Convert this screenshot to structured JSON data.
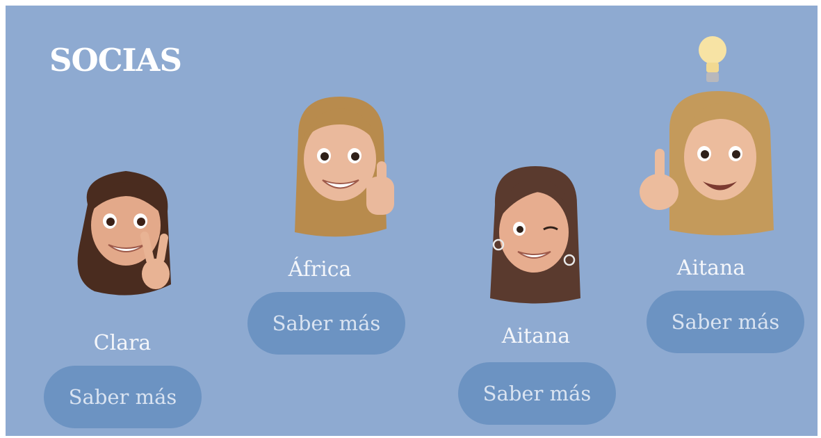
{
  "section": {
    "title": "SOCIAS"
  },
  "members": [
    {
      "name": "Clara",
      "button_label": "Saber más",
      "gesture": "peace-sign",
      "hair_color": "#4a2c1f"
    },
    {
      "name": "África",
      "button_label": "Saber más",
      "gesture": "thumbs-up",
      "hair_color": "#b88b4d"
    },
    {
      "name": "Aitana",
      "button_label": "Saber más",
      "gesture": "wink",
      "hair_color": "#5a3a2e"
    },
    {
      "name": "Aitana",
      "button_label": "Saber más",
      "gesture": "index-finger-idea",
      "hair_color": "#c49a5b"
    }
  ],
  "colors": {
    "panel_bg": "#8eaad1",
    "button_bg": "#6c93c2",
    "button_text": "#d9e3f1",
    "title_text": "#ffffff"
  },
  "icons": {
    "idea": "lightbulb-icon"
  }
}
